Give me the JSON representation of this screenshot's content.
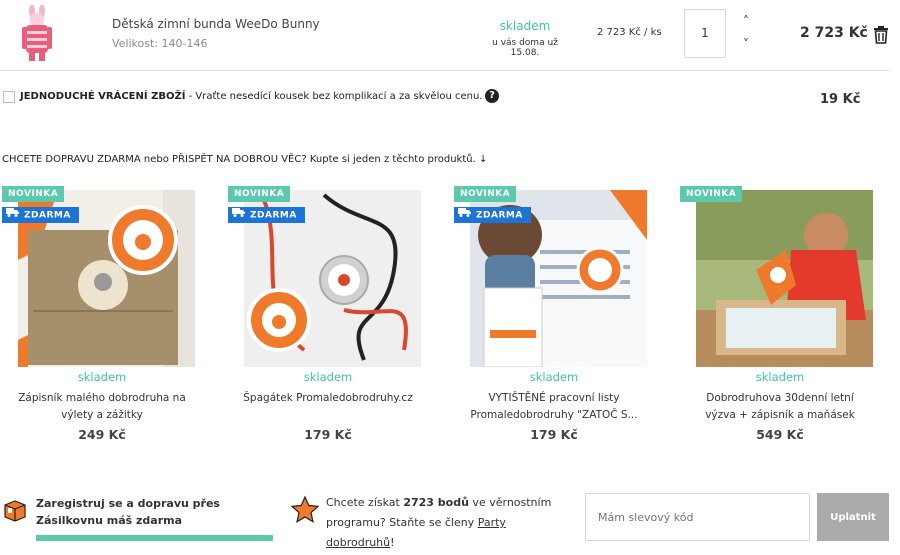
{
  "cart_item": {
    "name": "Dětská zimní bunda WeeDo Bunny",
    "size": "Velikost: 140-146",
    "stock": "skladem",
    "delivery": "u vás doma už 15.08.",
    "unit_price": "2 723 Kč / ks",
    "quantity": "1",
    "total": "2 723 Kč",
    "up_arrow": "˄",
    "down_arrow": "˅"
  },
  "return_option": {
    "label_bold": "JEDNODUCHÉ VRÁCENÍ ZBOŽÍ",
    "label_rest": " - Vraťte nesedící kousek bez komplikací a za skvělou cenu.",
    "help": "?",
    "price": "19 Kč"
  },
  "promo_heading": "CHCETE DOPRAVU ZDARMA nebo PŘISPĚT  NA DOBROU VĚC? Kupte si jeden z těchto produktů. ↓",
  "badges": {
    "new": "NOVINKA",
    "free": "ZDARMA"
  },
  "products": [
    {
      "stock": "skladem",
      "title": "Zápisník malého dobrodruha na výlety a zážitky",
      "price": "249 Kč"
    },
    {
      "stock": "skladem",
      "title": "Špagátek Promaledobrodruhy.cz",
      "price": "179 Kč"
    },
    {
      "stock": "skladem",
      "title": "VYTIŠTĚNÉ pracovní listy Promaledobrodruhy \"ZATOČ S...",
      "price": "179 Kč"
    },
    {
      "stock": "skladem",
      "title": "Dobrodruhova 30denní letní výzva + zápisník a maňásek",
      "price": "549 Kč"
    }
  ],
  "register": {
    "text": "Zaregistruj se a dopravu přes Zásilkovnu máš zdarma"
  },
  "loyalty": {
    "pre": "Chcete získat ",
    "points": "2723 bodů",
    "mid": " ve věrnostním programu? Staňte se členy ",
    "link": "Party dobrodruhů",
    "end": "!"
  },
  "coupon": {
    "placeholder": "Mám slevový kód",
    "button": "Uplatnit"
  },
  "colors": {
    "accent_green": "#5cc9ad",
    "badge_blue": "#1e73d6",
    "stock_green": "#3cc4a4",
    "button_gray": "#aaaaaa"
  },
  "icons": [
    "trash-icon",
    "help-icon",
    "truck-icon",
    "box-icon",
    "star-icon"
  ]
}
